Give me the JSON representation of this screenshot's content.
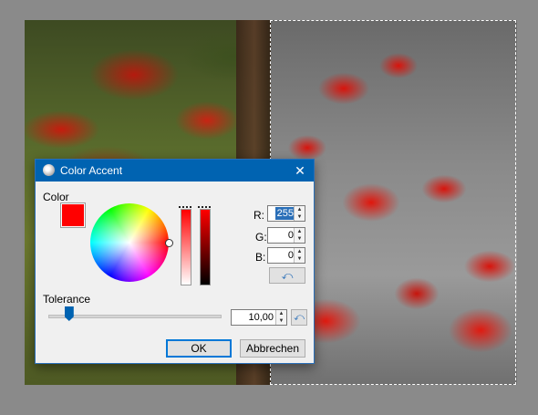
{
  "dialog": {
    "title": "Color Accent",
    "close_glyph": "✕",
    "color_label": "Color",
    "swatch_color": "#ff0000",
    "rgb": {
      "r_label": "R:",
      "r_value": "255",
      "g_label": "G:",
      "g_value": "0",
      "b_label": "B:",
      "b_value": "0"
    },
    "tolerance_label": "Tolerance",
    "tolerance_value": "10,00",
    "tolerance_fraction": 0.1,
    "reset_glyph": "⤺",
    "ok_label": "OK",
    "cancel_label": "Abbrechen"
  },
  "colors": {
    "titlebar": "#0063b1",
    "accent": "#ff0000"
  },
  "icons": {
    "title": "app-icon",
    "close": "close-icon",
    "reset": "undo-icon"
  }
}
